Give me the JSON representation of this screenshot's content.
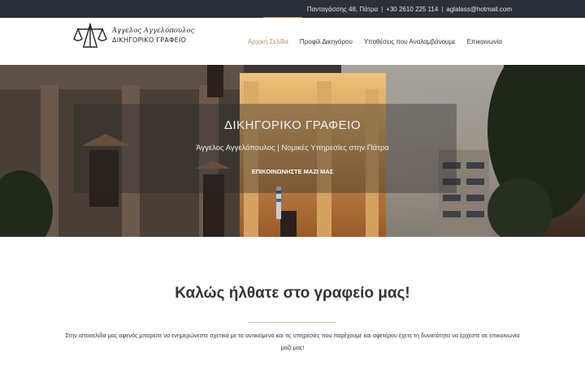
{
  "topbar": {
    "address": "Πανταγάσσης 48, Πάτρα",
    "phone": "+30 2610 225 114",
    "email": "aglalass@hotmail.com",
    "separator": "|"
  },
  "logo": {
    "name": "Άγγελος Αγγελόπουλος",
    "subtitle": "ΔΙΚΗΓΟΡΙΚΟ ΓΡΑΦΕΙΟ"
  },
  "nav": {
    "items": [
      {
        "label": "Αρχική Σελίδα",
        "active": true
      },
      {
        "label": "Προφίλ Δικηγόρου",
        "active": false
      },
      {
        "label": "Υποθέσεις που Αναλαμβάνουμε",
        "active": false
      },
      {
        "label": "Επικοινωνία",
        "active": false
      }
    ]
  },
  "hero": {
    "title": "ΔΙΚΗΓΟΡΙΚΟ ΓΡΑΦΕΙΟ",
    "subtitle": "Άγγελος Αγγελόπουλος | Νομικές Υπηρεσίες στην Πάτρα",
    "cta": "ΕΠΙΚΟΙΝΩΝΗΣΤΕ ΜΑΖΙ ΜΑΣ"
  },
  "welcome": {
    "title": "Καλώς ήλθατε στο γραφείο μας!",
    "text": "Στην ιστοσελίδα μας αφενός μπορείτε να ενημερώνεστε σχετικά με τα αντικείμενα και τις υπηρεσίες που παρέχουμε και αφετέρου έχετε τη δυνατότητα να έρχεστε σε επικοινωνία μαζί μας!"
  },
  "colors": {
    "accent": "#b8926a",
    "topbar_bg": "#2b3038"
  }
}
